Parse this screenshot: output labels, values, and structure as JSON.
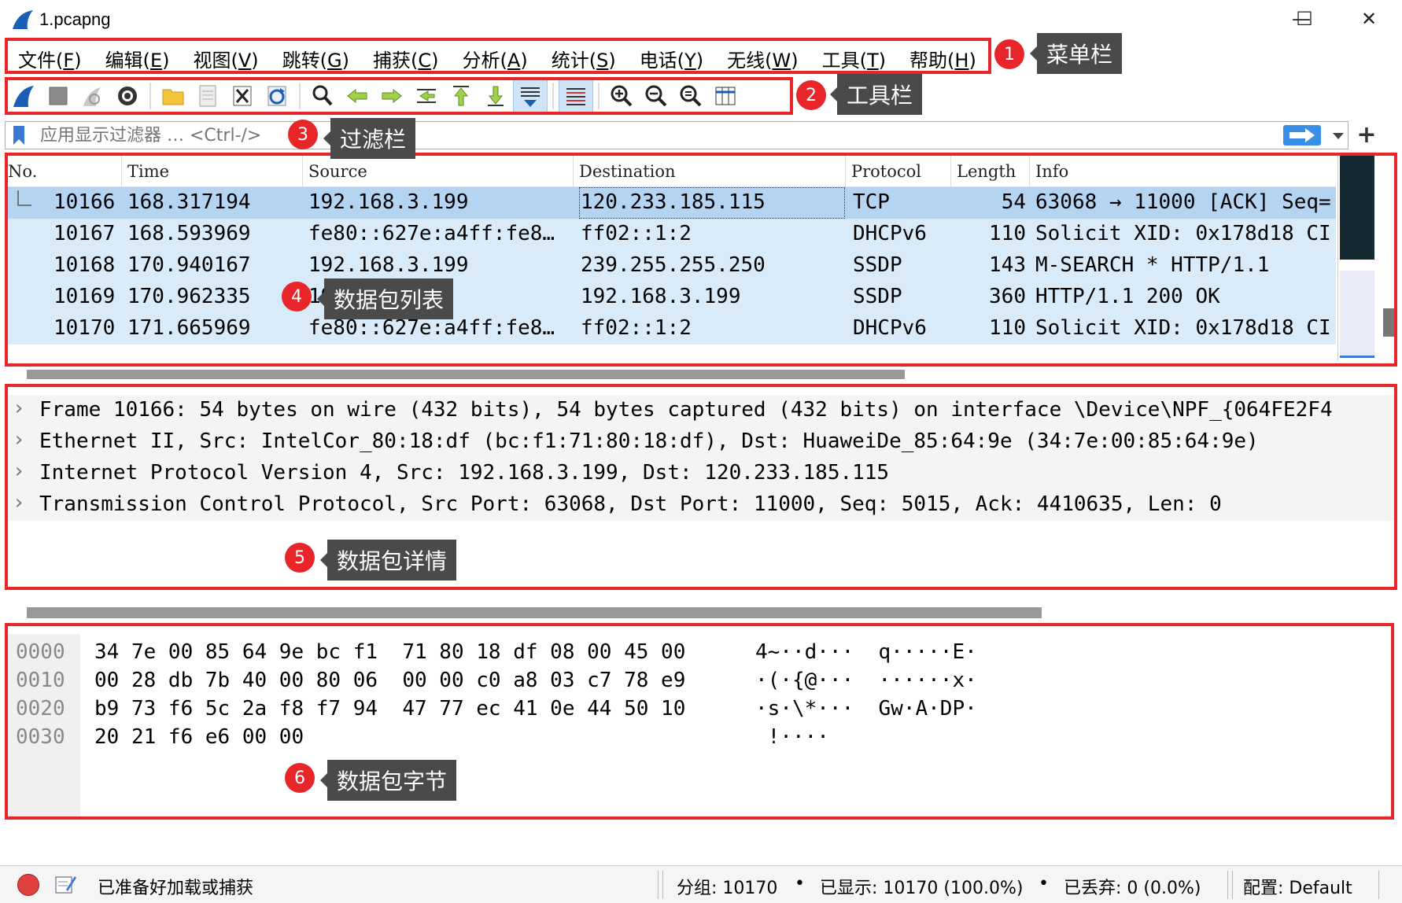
{
  "window": {
    "title": "1.pcapng",
    "minimize": "—",
    "maximize": "☐",
    "close": "✕"
  },
  "menu": [
    {
      "label": "文件(",
      "key": "F",
      "end": ")"
    },
    {
      "label": "编辑(",
      "key": "E",
      "end": ")"
    },
    {
      "label": "视图(",
      "key": "V",
      "end": ")"
    },
    {
      "label": "跳转(",
      "key": "G",
      "end": ")"
    },
    {
      "label": "捕获(",
      "key": "C",
      "end": ")"
    },
    {
      "label": "分析(",
      "key": "A",
      "end": ")"
    },
    {
      "label": "统计(",
      "key": "S",
      "end": ")"
    },
    {
      "label": "电话(",
      "key": "Y",
      "end": ")"
    },
    {
      "label": "无线(",
      "key": "W",
      "end": ")"
    },
    {
      "label": "工具(",
      "key": "T",
      "end": ")"
    },
    {
      "label": "帮助(",
      "key": "H",
      "end": ")"
    }
  ],
  "toolbar_icons": [
    "start-capture-icon",
    "stop-capture-icon",
    "restart-capture-icon",
    "capture-options-icon",
    "open-file-icon",
    "save-file-icon",
    "close-file-icon",
    "reload-file-icon",
    "find-packet-icon",
    "go-back-icon",
    "go-forward-icon",
    "go-to-packet-icon",
    "go-first-icon",
    "go-last-icon",
    "autoscroll-icon",
    "colorize-icon",
    "zoom-in-icon",
    "zoom-out-icon",
    "zoom-normal-icon",
    "resize-columns-icon"
  ],
  "filter": {
    "placeholder": "应用显示过滤器 … <Ctrl-/>",
    "plus": "+"
  },
  "packet_list": {
    "columns": [
      "No.",
      "Time",
      "Source",
      "Destination",
      "Protocol",
      "Length",
      "Info"
    ],
    "rows": [
      {
        "no": "10166",
        "time": "168.317194",
        "source": "192.168.3.199",
        "destination": "120.233.185.115",
        "protocol": "TCP",
        "length": "54",
        "info": "63068 → 11000 [ACK] Seq="
      },
      {
        "no": "10167",
        "time": "168.593969",
        "source": "fe80::627e:a4ff:fe8…",
        "destination": "ff02::1:2",
        "protocol": "DHCPv6",
        "length": "110",
        "info": "Solicit XID: 0x178d18 CI"
      },
      {
        "no": "10168",
        "time": "170.940167",
        "source": "192.168.3.199",
        "destination": "239.255.255.250",
        "protocol": "SSDP",
        "length": "143",
        "info": "M-SEARCH * HTTP/1.1"
      },
      {
        "no": "10169",
        "time": "170.962335",
        "source": "192.168.3.1",
        "destination": "192.168.3.199",
        "protocol": "SSDP",
        "length": "360",
        "info": "HTTP/1.1 200 OK"
      },
      {
        "no": "10170",
        "time": "171.665969",
        "source": "fe80::627e:a4ff:fe8…",
        "destination": "ff02::1:2",
        "protocol": "DHCPv6",
        "length": "110",
        "info": "Solicit XID: 0x178d18 CI"
      }
    ]
  },
  "details": [
    {
      "arrow": "›",
      "text": "Frame 10166: 54 bytes on wire (432 bits), 54 bytes captured (432 bits) on interface \\Device\\NPF_{064FE2F4"
    },
    {
      "arrow": "›",
      "text": "Ethernet II, Src: IntelCor_80:18:df (bc:f1:71:80:18:df), Dst: HuaweiDe_85:64:9e (34:7e:00:85:64:9e)"
    },
    {
      "arrow": "›",
      "text": "Internet Protocol Version 4, Src: 192.168.3.199, Dst: 120.233.185.115"
    },
    {
      "arrow": "›",
      "text": "Transmission Control Protocol, Src Port: 63068, Dst Port: 11000, Seq: 5015, Ack: 4410635, Len: 0"
    }
  ],
  "bytes": [
    {
      "offset": "0000",
      "hex": "34 7e 00 85 64 9e bc f1  71 80 18 df 08 00 45 00",
      "ascii": "4~··d···  q·····E·"
    },
    {
      "offset": "0010",
      "hex": "00 28 db 7b 40 00 80 06  00 00 c0 a8 03 c7 78 e9",
      "ascii": "·(·{@···  ······x·"
    },
    {
      "offset": "0020",
      "hex": "b9 73 f6 5c 2a f8 f7 94  47 77 ec 41 0e 44 50 10",
      "ascii": "·s·\\*···  Gw·A·DP·"
    },
    {
      "offset": "0030",
      "hex": "20 21 f6 e6 00 00",
      "ascii": " !····"
    }
  ],
  "status": {
    "ready": "已准备好加载或捕获",
    "packets": "分组: 10170",
    "displayed": "已显示: 10170 (100.0%)",
    "dropped": "已丢弃: 0 (0.0%)",
    "profile": "配置: Default",
    "bullet": "•"
  },
  "annotations": [
    {
      "num": "1",
      "label": "菜单栏"
    },
    {
      "num": "2",
      "label": "工具栏"
    },
    {
      "num": "3",
      "label": "过滤栏"
    },
    {
      "num": "4",
      "label": "数据包列表"
    },
    {
      "num": "5",
      "label": "数据包详情"
    },
    {
      "num": "6",
      "label": "数据包字节"
    }
  ],
  "colors": {
    "annotation_red": "#e8262a",
    "callout_bg": "#4a4a4a",
    "row_bg": "#d9ebf9",
    "row_selected": "#b4d4f2"
  }
}
